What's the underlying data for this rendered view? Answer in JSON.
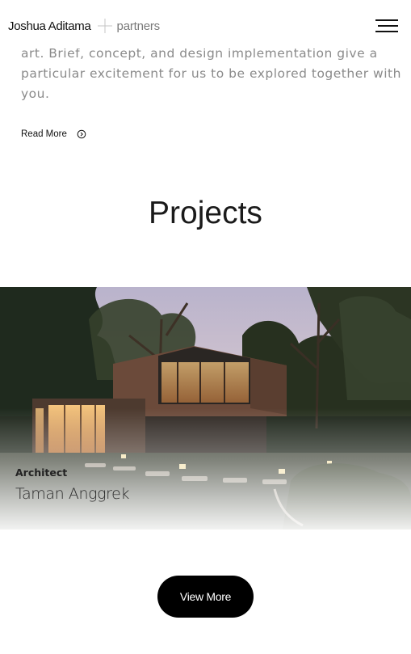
{
  "header": {
    "brand_name": "Joshua Aditama",
    "brand_suffix": "partners",
    "menu_icon": "hamburger-menu-icon"
  },
  "intro": {
    "lines": [
      "art. Brief, concept, and design implementation give a",
      "particular excitement for us to be explored together with",
      "you."
    ],
    "read_more_label": "Read More",
    "read_more_icon": "circled-chevron-right-icon"
  },
  "projects": {
    "title": "Projects",
    "items": [
      {
        "category": "Architect",
        "name": "Taman Anggrek"
      }
    ],
    "view_more_label": "View More"
  }
}
